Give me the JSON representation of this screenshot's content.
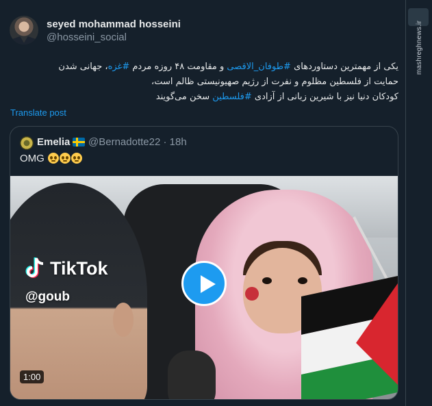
{
  "author": {
    "name": "seyed mohammad hosseini",
    "handle": "@hosseini_social"
  },
  "tweet": {
    "line1_prefix": "یکی از مهمترین دستاوردهای ",
    "hashtag1": "#طوفان_الاقصی",
    "line1_mid": " و مقاومت ۴۸ روزه مردم ",
    "hashtag2": "#غزه",
    "line1_suffix": "، جهانی شدن",
    "line2": "حمایت از فلسطین مظلوم و نفرت از رژیم صهیونیستی ظالم است،",
    "line3_prefix": "کودکان دنیا نیز با شیرین زبانی از آزادی ",
    "hashtag3": "#فلسطین",
    "line3_suffix": " سخن می‌گویند"
  },
  "translate_label": "Translate post",
  "quoted": {
    "name": "Emelia",
    "meta": "@Bernadotte22 · 18h",
    "text": "OMG",
    "flag_icon": "sweden-flag-icon",
    "emoji_icon": "pleading-face-emoji"
  },
  "media": {
    "tiktok_label": "TikTok",
    "tiktok_user": "@goub",
    "duration": "1:00",
    "play_icon": "play-icon"
  },
  "watermark": {
    "site": "mashreghnews.ir",
    "logo_icon": "mashregh-logo-icon"
  },
  "colors": {
    "background": "#15202b",
    "link": "#1d9bf0",
    "muted": "#8b98a5",
    "text": "#e7e9ea",
    "border": "#38444d"
  }
}
